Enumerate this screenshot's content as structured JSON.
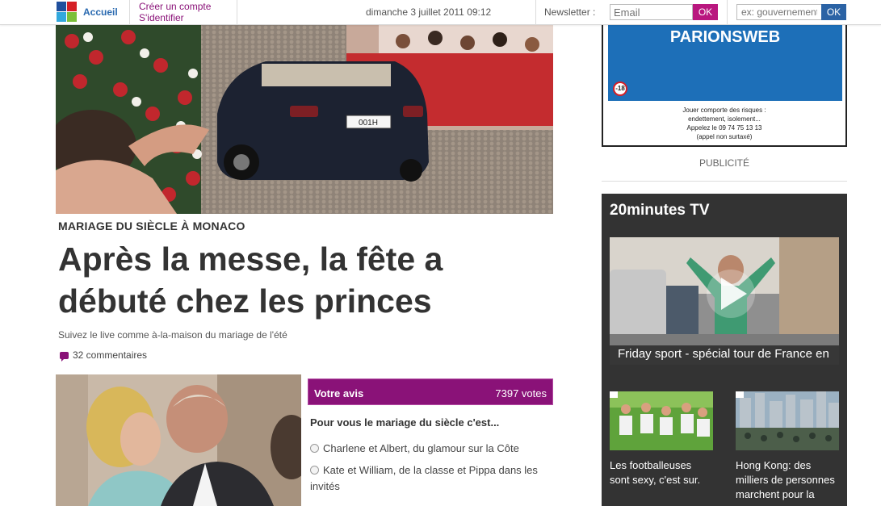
{
  "topbar": {
    "home_label": "Accueil",
    "create_account": "Créer un compte",
    "login": "S'identifier",
    "datetime": "dimanche 3 juillet 2011 09:12",
    "newsletter_label": "Newsletter :",
    "newsletter_placeholder": "Email",
    "newsletter_ok": "OK",
    "search_placeholder": "ex: gouvernement",
    "search_ok": "OK"
  },
  "article": {
    "plate": "001H",
    "kicker": "MARIAGE DU SIÈCLE À MONACO",
    "headline": "Après la messe, la fête a débuté chez les princes",
    "subtitle": "Suivez le live comme à-la-maison du mariage de l'été",
    "comments": "32 commentaires"
  },
  "poll": {
    "title": "Votre avis",
    "votes": "7397 votes",
    "question": "Pour vous le mariage du siècle c'est...",
    "options": [
      "Charlene et Albert, du glamour sur la Côte",
      "Kate et William, de la classe et Pippa dans les invités"
    ]
  },
  "ad": {
    "brand": "PARIONSWEB",
    "age_limit": "-18",
    "notice_lines": [
      "Jouer comporte des risques :",
      "endettement, isolement...",
      "Appelez le 09 74 75 13 13",
      "(appel non surtaxé)"
    ],
    "label": "PUBLICITÉ"
  },
  "tv": {
    "title": "20minutes TV",
    "featured_caption": "Friday sport - spécial tour de France en",
    "thumbs": [
      {
        "caption": "Les footballeuses sont sexy, c'est sur."
      },
      {
        "caption": "Hong Kong: des milliers de personnes marchent pour la"
      }
    ]
  },
  "colors": {
    "accent_purple": "#8a1278",
    "accent_blue": "#2b63a5",
    "tv_background": "#333333"
  }
}
